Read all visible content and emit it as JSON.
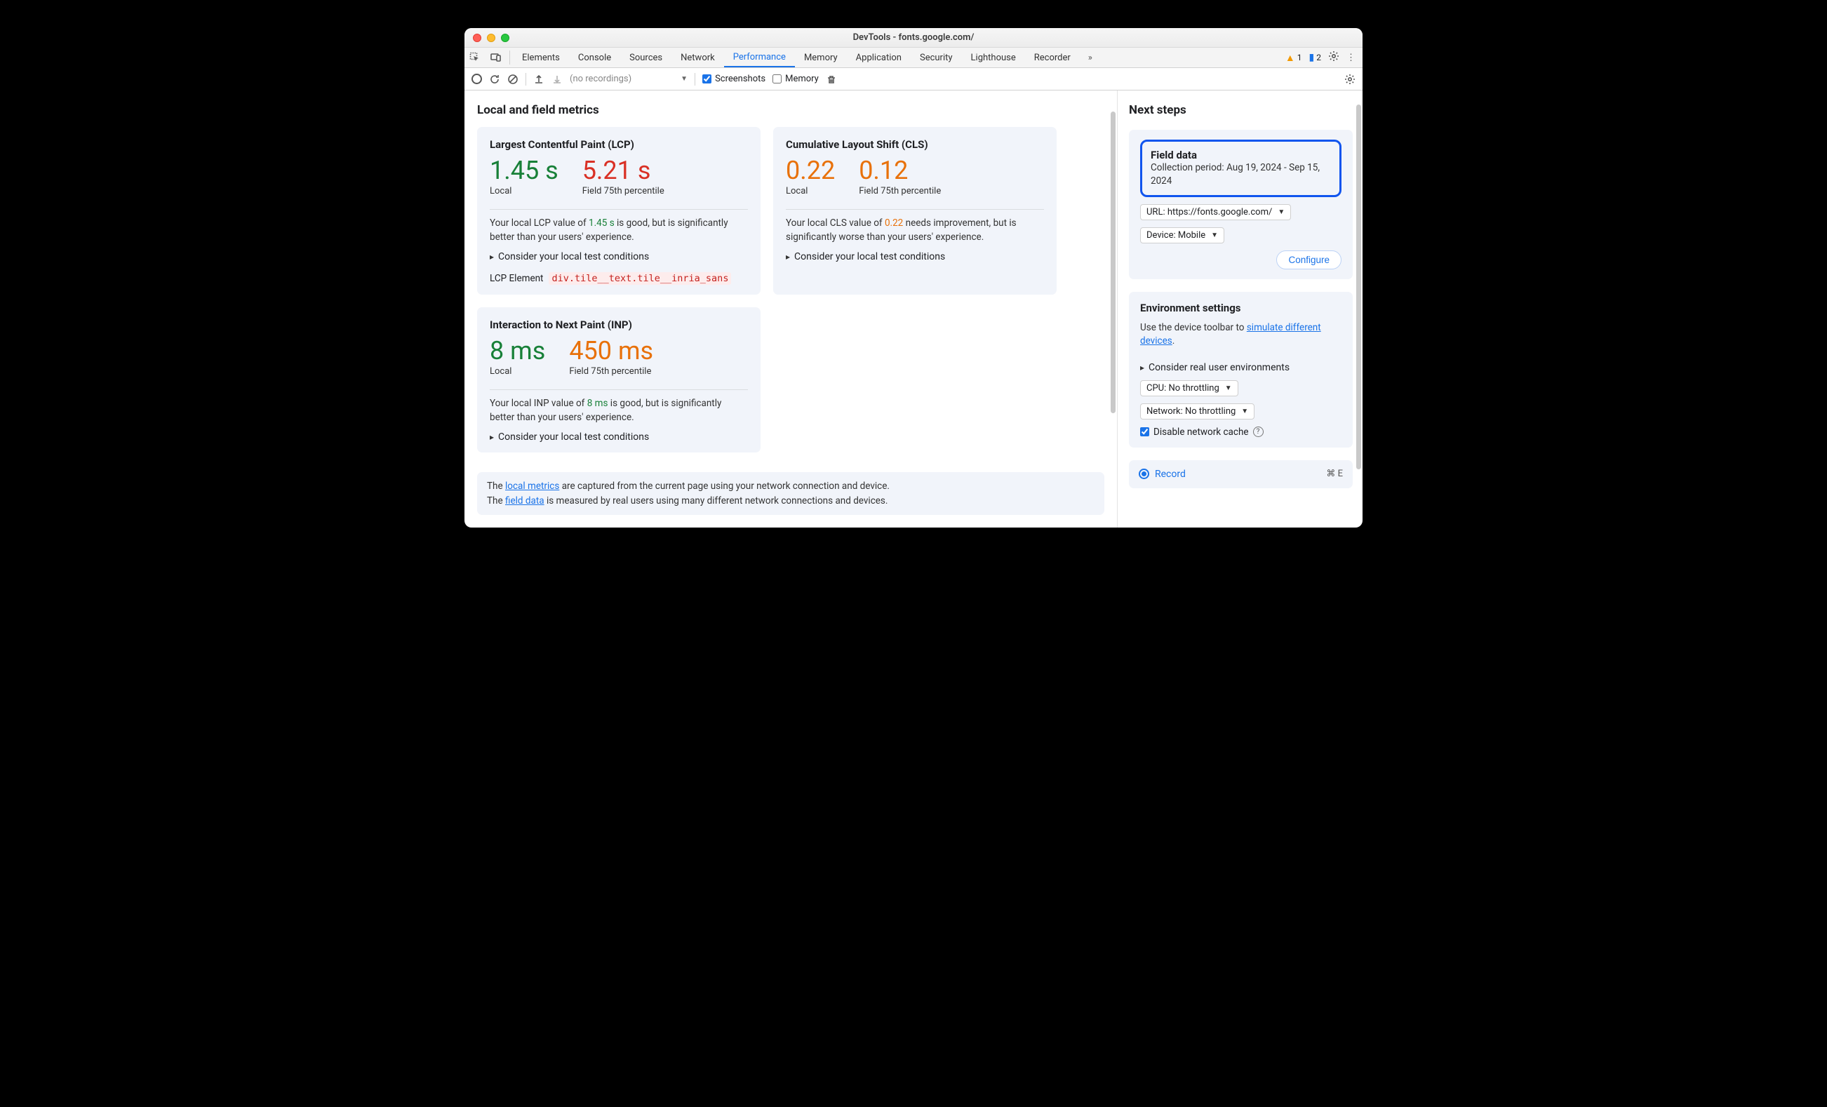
{
  "window_title": "DevTools - fonts.google.com/",
  "tabs": [
    "Elements",
    "Console",
    "Sources",
    "Network",
    "Performance",
    "Memory",
    "Application",
    "Security",
    "Lighthouse",
    "Recorder"
  ],
  "active_tab": "Performance",
  "warnings_count": "1",
  "messages_count": "2",
  "toolbar": {
    "recordings_placeholder": "(no recordings)",
    "screenshots_label": "Screenshots",
    "memory_label": "Memory"
  },
  "main_heading": "Local and field metrics",
  "lcp": {
    "title": "Largest Contentful Paint (LCP)",
    "local_val": "1.45 s",
    "local_sub": "Local",
    "field_val": "5.21 s",
    "field_sub": "Field 75th percentile",
    "desc_pre": "Your local LCP value of ",
    "desc_val": "1.45 s",
    "desc_post": " is good, but is significantly better than your users' experience.",
    "expander": "Consider your local test conditions",
    "el_label": "LCP Element",
    "el_selector": "div.tile__text.tile__inria_sans"
  },
  "cls": {
    "title": "Cumulative Layout Shift (CLS)",
    "local_val": "0.22",
    "local_sub": "Local",
    "field_val": "0.12",
    "field_sub": "Field 75th percentile",
    "desc_pre": "Your local CLS value of ",
    "desc_val": "0.22",
    "desc_post": " needs improvement, but is significantly worse than your users' experience.",
    "expander": "Consider your local test conditions"
  },
  "inp": {
    "title": "Interaction to Next Paint (INP)",
    "local_val": "8 ms",
    "local_sub": "Local",
    "field_val": "450 ms",
    "field_sub": "Field 75th percentile",
    "desc_pre": "Your local INP value of ",
    "desc_val": "8 ms",
    "desc_post": " is good, but is significantly better than your users' experience.",
    "expander": "Consider your local test conditions"
  },
  "footnote": {
    "l1_pre": "The ",
    "l1_link": "local metrics",
    "l1_post": " are captured from the current page using your network connection and device.",
    "l2_pre": "The ",
    "l2_link": "field data",
    "l2_post": " is measured by real users using many different network connections and devices."
  },
  "side_heading": "Next steps",
  "field_data": {
    "title": "Field data",
    "period_label": "Collection period: ",
    "period_value": "Aug 19, 2024 - Sep 15, 2024",
    "url_label": "URL: https://fonts.google.com/",
    "device_label": "Device: Mobile",
    "configure": "Configure"
  },
  "env": {
    "title": "Environment settings",
    "desc_pre": "Use the device toolbar to ",
    "desc_link": "simulate different devices",
    "desc_post": ".",
    "expander": "Consider real user environments",
    "cpu_label": "CPU: No throttling",
    "net_label": "Network: No throttling",
    "cache_label": "Disable network cache"
  },
  "record": {
    "label": "Record",
    "shortcut": "⌘ E"
  }
}
